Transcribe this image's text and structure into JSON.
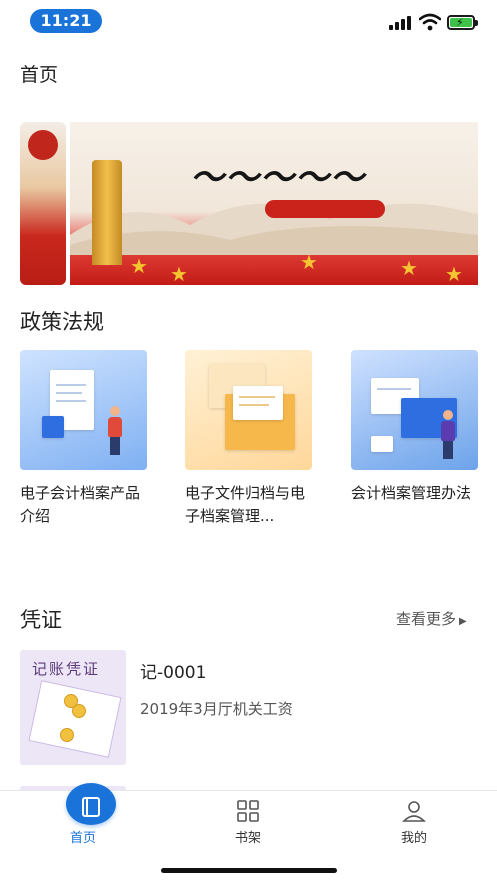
{
  "status_bar": {
    "time": "11:21"
  },
  "header": {
    "title": "首页"
  },
  "sections": {
    "policy_title": "政策法规",
    "voucher_title": "凭证",
    "voucher_more": "查看更多"
  },
  "policy_cards": [
    {
      "label": "电子会计档案产品介绍"
    },
    {
      "label": "电子文件归档与电子档案管理..."
    },
    {
      "label": "会计档案管理办法"
    }
  ],
  "vouchers": [
    {
      "thumb_title": "记账凭证",
      "id": "记-0001",
      "desc": "2019年3月厅机关工资"
    }
  ],
  "tabs": [
    {
      "label": "首页",
      "icon": "book-icon",
      "active": true
    },
    {
      "label": "书架",
      "icon": "grid-icon",
      "active": false
    },
    {
      "label": "我的",
      "icon": "user-icon",
      "active": false
    }
  ],
  "colors": {
    "accent": "#1a73d9",
    "battery": "#3fc24a"
  }
}
